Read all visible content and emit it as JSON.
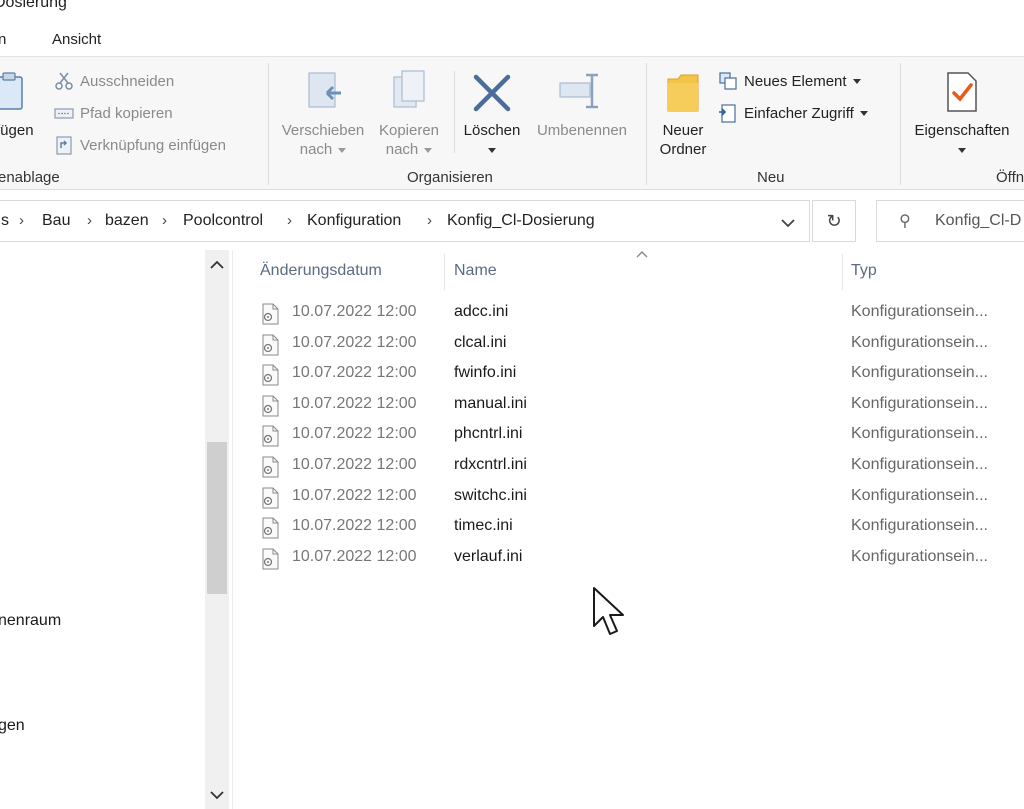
{
  "window": {
    "title": "Dosierung"
  },
  "ribbon_tabs": [
    {
      "label": "n"
    },
    {
      "label": "Ansicht"
    }
  ],
  "clipboard": {
    "paste_label": "fügen",
    "cut": "Ausschneiden",
    "copy_path": "Pfad kopieren",
    "paste_shortcut": "Verknüpfung einfügen",
    "group_label": "enablage"
  },
  "organize": {
    "move_to_line1": "Verschieben",
    "move_to_line2": "nach",
    "copy_to_line1": "Kopieren",
    "copy_to_line2": "nach",
    "delete": "Löschen",
    "rename": "Umbenennen",
    "group_label": "Organisieren"
  },
  "new": {
    "new_folder_line1": "Neuer",
    "new_folder_line2": "Ordner",
    "new_item": "Neues Element",
    "easy_access": "Einfacher Zugriff",
    "group_label": "Neu"
  },
  "open": {
    "properties": "Eigenschaften",
    "group_label": "Öffn"
  },
  "address": {
    "crumbs": [
      "s",
      "Bau",
      "bazen",
      "Poolcontrol",
      "Konfiguration",
      "Konfig_Cl-Dosierung"
    ],
    "search_placeholder": "Konfig_Cl-D"
  },
  "nav_pane": {
    "items": [
      "nenraum",
      "gen"
    ]
  },
  "columns": {
    "date": "Änderungsdatum",
    "name": "Name",
    "type": "Typ"
  },
  "files": [
    {
      "date": "10.07.2022 12:00",
      "name": "adcc.ini",
      "type": "Konfigurationsein..."
    },
    {
      "date": "10.07.2022 12:00",
      "name": "clcal.ini",
      "type": "Konfigurationsein..."
    },
    {
      "date": "10.07.2022 12:00",
      "name": "fwinfo.ini",
      "type": "Konfigurationsein..."
    },
    {
      "date": "10.07.2022 12:00",
      "name": "manual.ini",
      "type": "Konfigurationsein..."
    },
    {
      "date": "10.07.2022 12:00",
      "name": "phcntrl.ini",
      "type": "Konfigurationsein..."
    },
    {
      "date": "10.07.2022 12:00",
      "name": "rdxcntrl.ini",
      "type": "Konfigurationsein..."
    },
    {
      "date": "10.07.2022 12:00",
      "name": "switchc.ini",
      "type": "Konfigurationsein..."
    },
    {
      "date": "10.07.2022 12:00",
      "name": "timec.ini",
      "type": "Konfigurationsein..."
    },
    {
      "date": "10.07.2022 12:00",
      "name": "verlauf.ini",
      "type": "Konfigurationsein..."
    }
  ]
}
